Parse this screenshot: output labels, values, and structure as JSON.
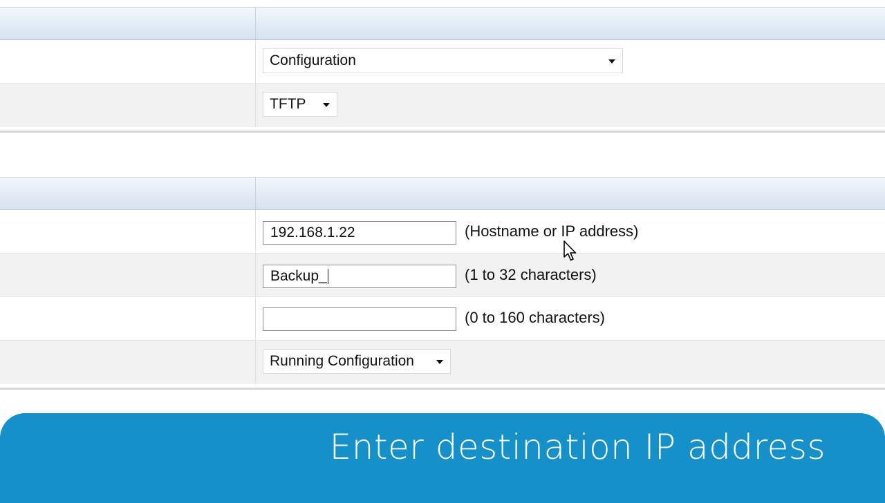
{
  "panel1": {
    "file_type": {
      "selected": "Configuration"
    },
    "protocol": {
      "selected": "TFTP"
    }
  },
  "panel2": {
    "server": {
      "value": "192.168.1.22",
      "hint": "(Hostname or IP address)"
    },
    "filename": {
      "value": "Backup_",
      "hint": "(1 to 32 characters)"
    },
    "path": {
      "value": "",
      "hint": "(0 to 160 characters)"
    },
    "source": {
      "selected": "Running Configuration"
    }
  },
  "banner": {
    "caption": "Enter destination IP address",
    "color": "#1690c8"
  },
  "icons": {
    "dropdown": "caret-down-icon",
    "pointer": "mouse-pointer-icon"
  }
}
